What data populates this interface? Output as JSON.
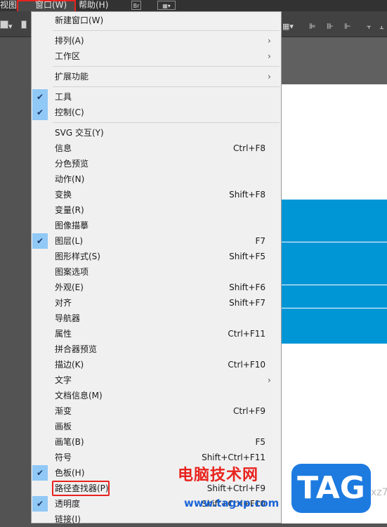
{
  "menubar": {
    "view": "视图(V)",
    "window": "窗口(W)",
    "help": "帮助(H)",
    "br_button": "Br"
  },
  "menu": {
    "items": [
      {
        "label": "新建窗口(W)"
      },
      {
        "label": "排列(A)",
        "submenu": true
      },
      {
        "label": "工作区",
        "submenu": true
      },
      {
        "label": "扩展功能",
        "submenu": true
      },
      {
        "label": "工具",
        "checked": true
      },
      {
        "label": "控制(C)",
        "checked": true
      },
      {
        "label": "SVG 交互(Y)"
      },
      {
        "label": "信息",
        "shortcut": "Ctrl+F8"
      },
      {
        "label": "分色预览"
      },
      {
        "label": "动作(N)"
      },
      {
        "label": "变换",
        "shortcut": "Shift+F8"
      },
      {
        "label": "变量(R)"
      },
      {
        "label": "图像描摹"
      },
      {
        "label": "图层(L)",
        "shortcut": "F7",
        "checked": true
      },
      {
        "label": "图形样式(S)",
        "shortcut": "Shift+F5"
      },
      {
        "label": "图案选项"
      },
      {
        "label": "外观(E)",
        "shortcut": "Shift+F6"
      },
      {
        "label": "对齐",
        "shortcut": "Shift+F7"
      },
      {
        "label": "导航器"
      },
      {
        "label": "属性",
        "shortcut": "Ctrl+F11"
      },
      {
        "label": "拼合器预览"
      },
      {
        "label": "描边(K)",
        "shortcut": "Ctrl+F10"
      },
      {
        "label": "文字",
        "submenu": true
      },
      {
        "label": "文档信息(M)"
      },
      {
        "label": "渐变",
        "shortcut": "Ctrl+F9"
      },
      {
        "label": "画板"
      },
      {
        "label": "画笔(B)",
        "shortcut": "F5"
      },
      {
        "label": "符号",
        "shortcut": "Shift+Ctrl+F11"
      },
      {
        "label": "色板(H)",
        "checked": true
      },
      {
        "label": "路径查找器(P)",
        "shortcut": "Shift+Ctrl+F9"
      },
      {
        "label": "透明度",
        "shortcut": "Shift+Ctrl+F10",
        "checked": true
      },
      {
        "label": "链接(I)"
      }
    ]
  },
  "watermark": {
    "site": "电脑技术网",
    "url": "www.tagxp.com",
    "logo": "TAG",
    "side_text": "xz7"
  },
  "colors": {
    "highlight": "#e8231e",
    "check_bg": "#90c8f6",
    "artboard_blue": "#0096d6"
  }
}
